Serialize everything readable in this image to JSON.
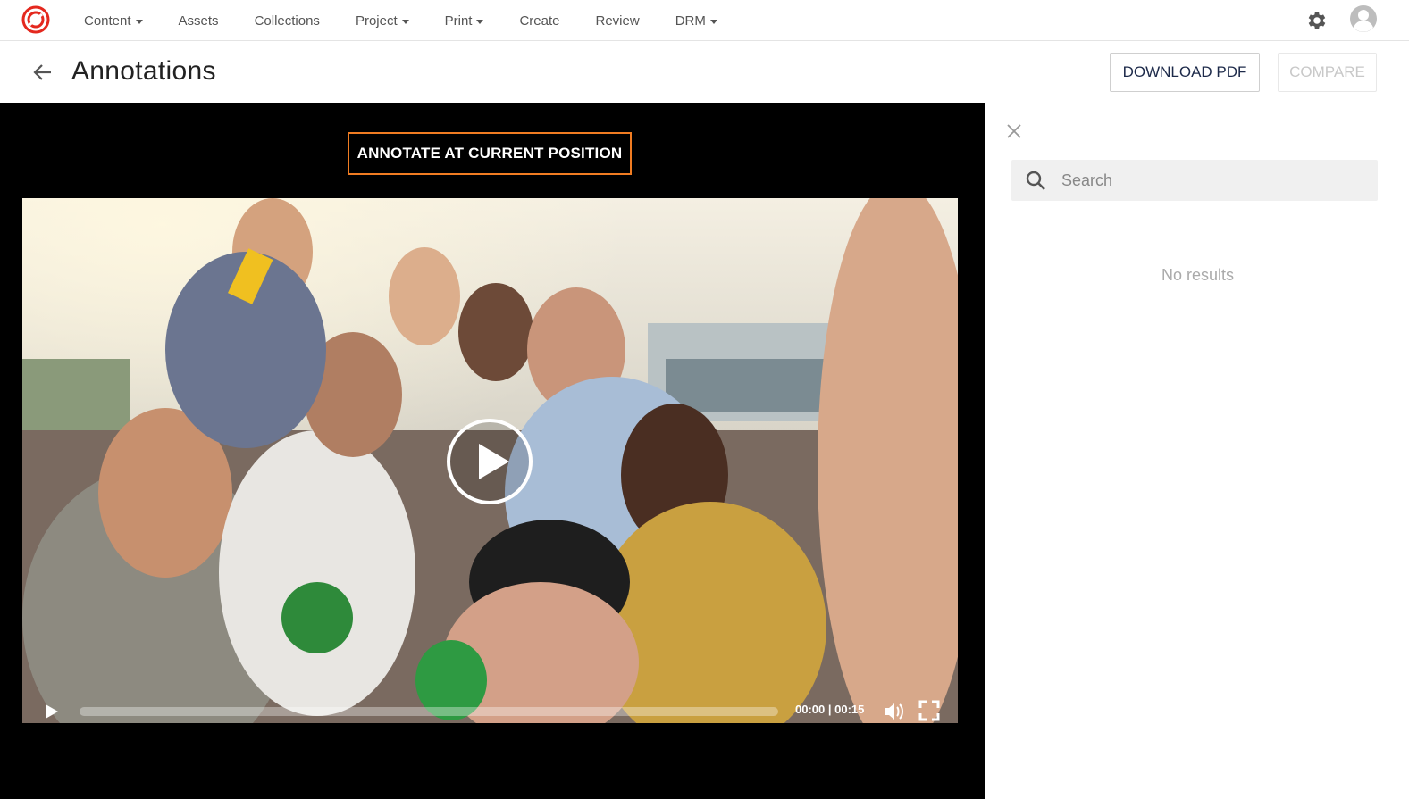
{
  "nav": {
    "items": [
      {
        "label": "Content",
        "dropdown": true
      },
      {
        "label": "Assets",
        "dropdown": false
      },
      {
        "label": "Collections",
        "dropdown": false
      },
      {
        "label": "Project",
        "dropdown": true
      },
      {
        "label": "Print",
        "dropdown": true
      },
      {
        "label": "Create",
        "dropdown": false
      },
      {
        "label": "Review",
        "dropdown": false
      },
      {
        "label": "DRM",
        "dropdown": true
      }
    ],
    "icons": {
      "logo": "app-logo-icon",
      "settings": "gear-icon",
      "user": "avatar-icon"
    },
    "brand_color": "#e4281e"
  },
  "header": {
    "title": "Annotations",
    "download_label": "DOWNLOAD PDF",
    "compare_label": "COMPARE",
    "compare_disabled": true
  },
  "player": {
    "annotate_label": "ANNOTATE AT CURRENT POSITION",
    "annotate_border_color": "#f07c22",
    "time_display": "00:00 | 00:15",
    "progress": 0
  },
  "side_panel": {
    "search_placeholder": "Search",
    "search_value": "",
    "empty_text": "No results"
  }
}
